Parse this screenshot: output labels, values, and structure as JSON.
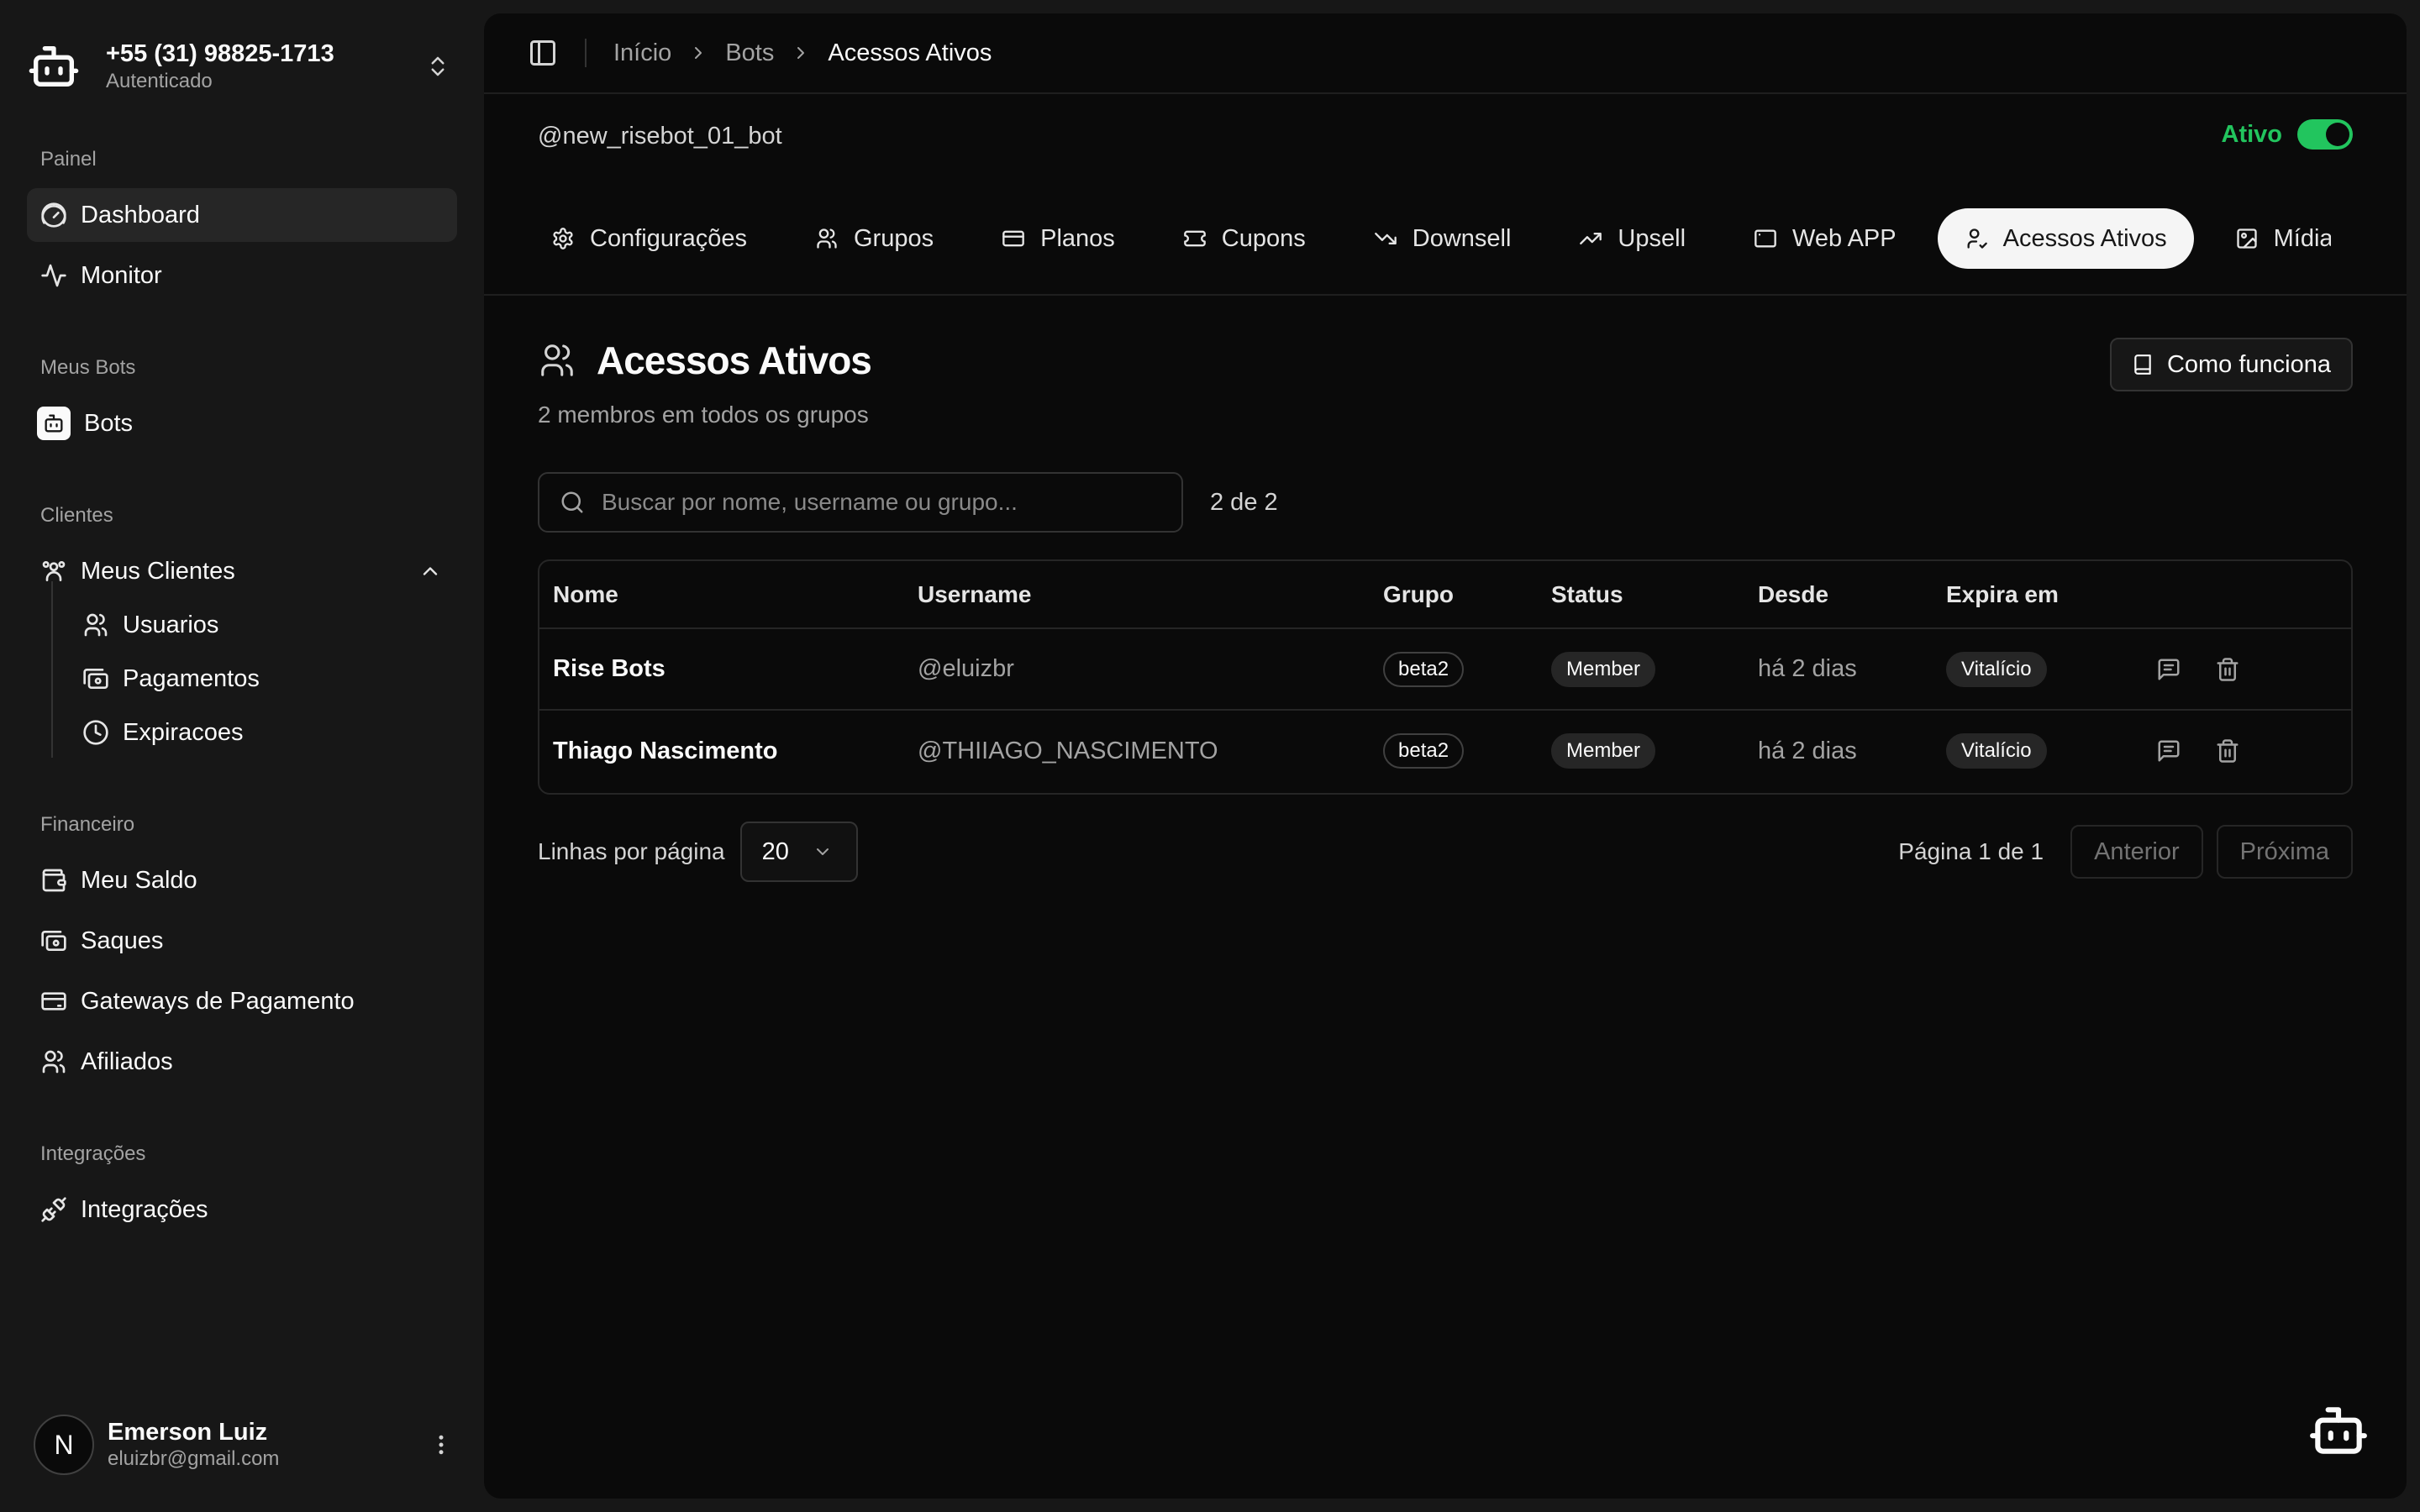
{
  "account": {
    "phone": "+55 (31) 98825-1713",
    "status": "Autenticado"
  },
  "sidebar": {
    "sections": {
      "painel": "Painel",
      "meus_bots": "Meus Bots",
      "clientes": "Clientes",
      "financeiro": "Financeiro",
      "integracoes": "Integrações"
    },
    "items": {
      "dashboard": "Dashboard",
      "monitor": "Monitor",
      "bots": "Bots",
      "meus_clientes": "Meus Clientes",
      "usuarios": "Usuarios",
      "pagamentos": "Pagamentos",
      "expiracoes": "Expiracoes",
      "meu_saldo": "Meu Saldo",
      "saques": "Saques",
      "gateways": "Gateways de Pagamento",
      "afiliados": "Afiliados",
      "integracoes": "Integrações"
    },
    "active": "Dashboard"
  },
  "user": {
    "initial": "N",
    "name": "Emerson Luiz",
    "email": "eluizbr@gmail.com"
  },
  "breadcrumb": [
    "Início",
    "Bots",
    "Acessos Ativos"
  ],
  "bot": {
    "handle": "@new_risebot_01_bot",
    "status_label": "Ativo",
    "enabled": true
  },
  "tabs": [
    {
      "label": "Configurações",
      "icon": "gear-icon"
    },
    {
      "label": "Grupos",
      "icon": "users-icon"
    },
    {
      "label": "Planos",
      "icon": "card-icon"
    },
    {
      "label": "Cupons",
      "icon": "ticket-icon"
    },
    {
      "label": "Downsell",
      "icon": "trending-down-icon"
    },
    {
      "label": "Upsell",
      "icon": "trending-up-icon"
    },
    {
      "label": "Web APP",
      "icon": "window-icon"
    },
    {
      "label": "Acessos Ativos",
      "icon": "user-check-icon",
      "active": true
    },
    {
      "label": "Mídias",
      "icon": "image-icon"
    }
  ],
  "page": {
    "title": "Acessos Ativos",
    "subtitle": "2 membros em todos os grupos",
    "how_button": "Como funciona"
  },
  "search": {
    "placeholder": "Buscar por nome, username ou grupo...",
    "value": "",
    "count": "2 de 2"
  },
  "table": {
    "columns": [
      "Nome",
      "Username",
      "Grupo",
      "Status",
      "Desde",
      "Expira em"
    ],
    "rows": [
      {
        "nome": "Rise Bots",
        "username": "@eluizbr",
        "grupo": "beta2",
        "status": "Member",
        "desde": "há 2 dias",
        "expira": "Vitalício"
      },
      {
        "nome": "Thiago Nascimento",
        "username": "@THIIAGO_NASCIMENTO",
        "grupo": "beta2",
        "status": "Member",
        "desde": "há 2 dias",
        "expira": "Vitalício"
      }
    ]
  },
  "pagination": {
    "rows_label": "Linhas por página",
    "rows_value": "20",
    "page_text": "Página 1 de 1",
    "prev": "Anterior",
    "next": "Próxima"
  },
  "colors": {
    "accent_green": "#22c55e",
    "background": "#0a0a0a",
    "sidebar": "#171717"
  }
}
